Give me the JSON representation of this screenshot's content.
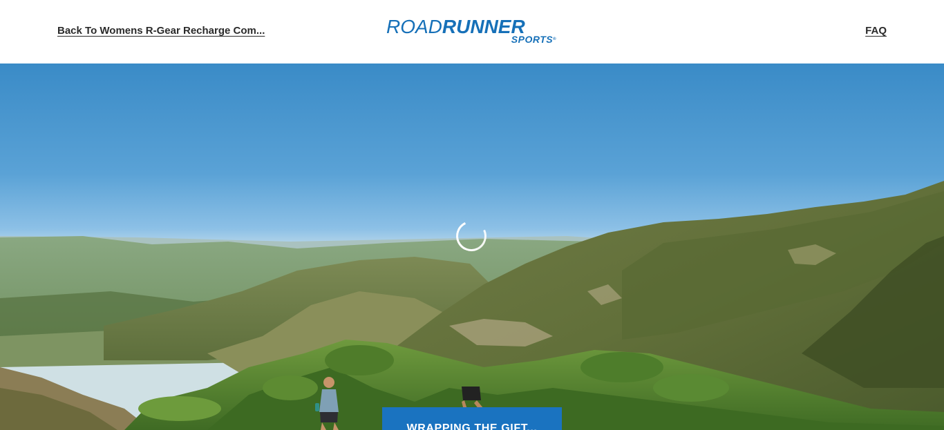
{
  "header": {
    "back_link": "Back To Womens R-Gear Recharge Com...",
    "faq_link": "FAQ",
    "logo": {
      "main_road": "ROAD",
      "main_runner": "RUNNER",
      "sub": "SPORTS",
      "registered": "®",
      "brand_color": "#1670b8"
    }
  },
  "hero": {
    "status_button": "WRAPPING THE GIFT...",
    "button_color": "#1a73c0",
    "spinner_icon": "loading-spinner"
  }
}
